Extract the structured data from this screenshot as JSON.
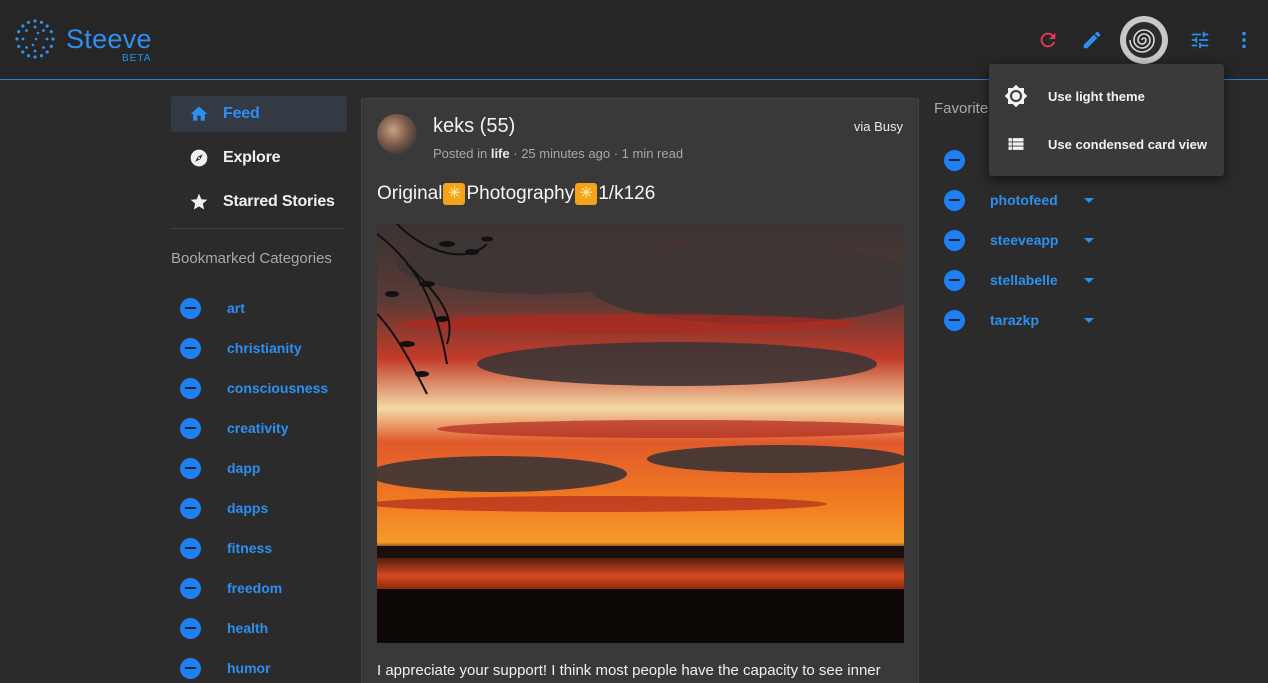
{
  "app": {
    "brand": "Steeve",
    "badge": "BETA"
  },
  "header": {
    "icons": [
      "refresh-icon",
      "pencil-icon",
      "avatar",
      "tune-icon",
      "more-vert-icon"
    ]
  },
  "nav": [
    {
      "label": "Feed",
      "icon": "home-icon",
      "active": true
    },
    {
      "label": "Explore",
      "icon": "compass-icon",
      "active": false
    },
    {
      "label": "Starred Stories",
      "icon": "star-icon",
      "active": false
    }
  ],
  "bookmarked": {
    "heading": "Bookmarked Categories",
    "items": [
      "art",
      "christianity",
      "consciousness",
      "creativity",
      "dapp",
      "dapps",
      "fitness",
      "freedom",
      "health",
      "humor"
    ]
  },
  "post": {
    "author": "keks (55)",
    "via": "via Busy",
    "meta_prefix": "Posted in",
    "category": "life",
    "meta_suffix": "· 25 minutes ago · 1 min read",
    "title_a": "Original",
    "title_b": "Photography",
    "title_c": "1/k126",
    "body_start": "I appreciate your support! I think most people have the capacity to see inner"
  },
  "favorites": {
    "heading": "Favorites",
    "items": [
      "",
      "photofeed",
      "steeveapp",
      "stellabelle",
      "tarazkp"
    ]
  },
  "menu": [
    {
      "label": "Use light theme",
      "icon": "brightness-icon"
    },
    {
      "label": "Use condensed card view",
      "icon": "list-view-icon"
    }
  ],
  "colors": {
    "accent": "#2f8ff0",
    "refresh": "#e8365d",
    "background": "#2b2b2b",
    "card": "#393939"
  }
}
